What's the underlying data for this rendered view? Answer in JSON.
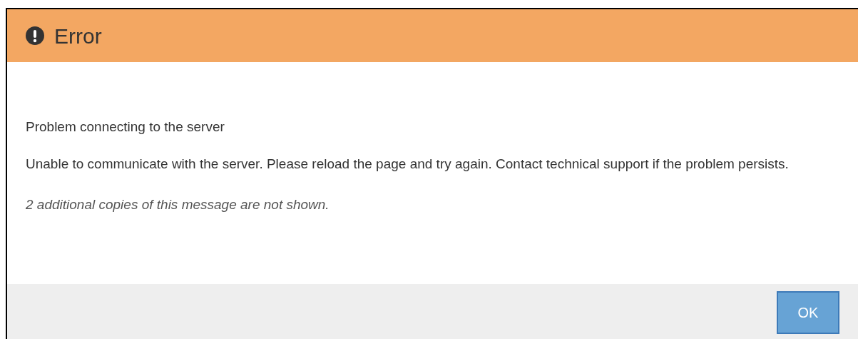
{
  "dialog": {
    "title": "Error",
    "heading": "Problem connecting to the server",
    "message": "Unable to communicate with the server. Please reload the page and try again. Contact technical support if the problem persists.",
    "note": "2 additional copies of this message are not shown.",
    "buttons": [
      "OK"
    ]
  }
}
